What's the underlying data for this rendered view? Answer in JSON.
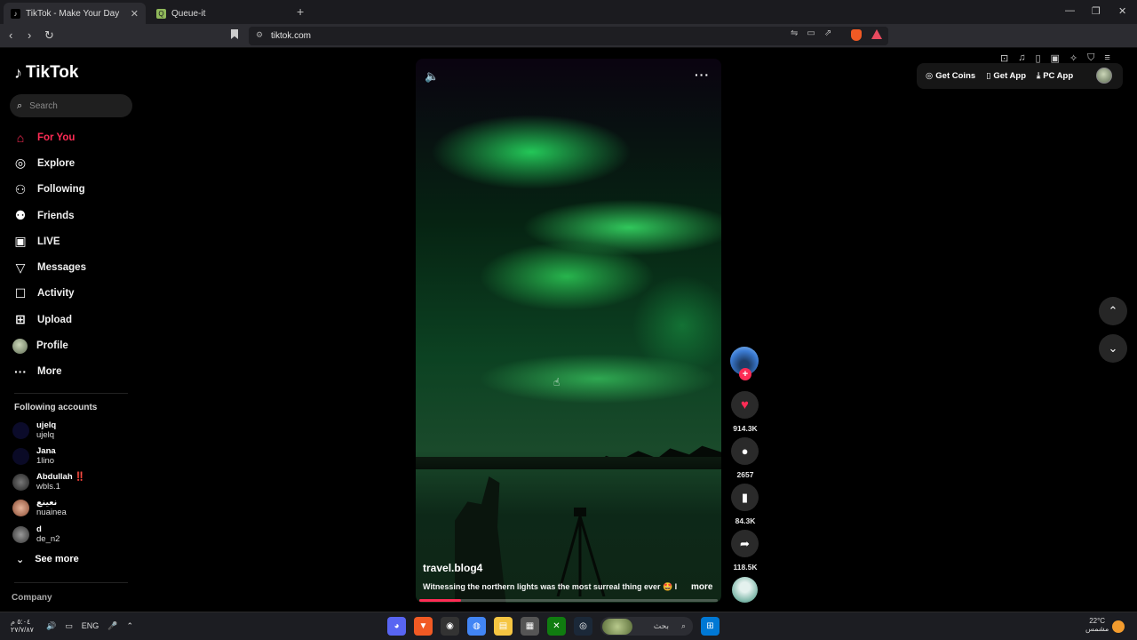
{
  "browser": {
    "tabs": [
      {
        "title": "TikTok - Make Your Day",
        "active": true
      },
      {
        "title": "Queue-it",
        "active": false
      }
    ],
    "url": "tiktok.com"
  },
  "sidebar": {
    "logo": "TikTok",
    "search_placeholder": "Search",
    "nav": [
      {
        "label": "For You",
        "icon": "home-icon",
        "active": true
      },
      {
        "label": "Explore",
        "icon": "compass-icon"
      },
      {
        "label": "Following",
        "icon": "following-icon"
      },
      {
        "label": "Friends",
        "icon": "friends-icon"
      },
      {
        "label": "LIVE",
        "icon": "live-icon"
      },
      {
        "label": "Messages",
        "icon": "messages-icon"
      },
      {
        "label": "Activity",
        "icon": "activity-icon"
      },
      {
        "label": "Upload",
        "icon": "upload-icon"
      },
      {
        "label": "Profile",
        "icon": "profile-avatar"
      },
      {
        "label": "More",
        "icon": "more-icon"
      }
    ],
    "following_title": "Following accounts",
    "accounts": [
      {
        "name": "ujelq",
        "handle": "ujelq"
      },
      {
        "name": "Jana",
        "handle": "1lino"
      },
      {
        "name": "Abdullah ‼️",
        "handle": "wbls.1"
      },
      {
        "name": "نعينع",
        "handle": "nuainea"
      },
      {
        "name": "d",
        "handle": "de_n2"
      }
    ],
    "see_more": "See more",
    "company": "Company"
  },
  "video": {
    "author": "travel.blog4",
    "caption": "Witnessing the northern lights was the most surreal thing ever 🤩 I",
    "caption_more": "more",
    "progress": 0.14
  },
  "actions": {
    "likes": "914.3K",
    "comments": "2657",
    "saves": "84.3K",
    "shares": "118.5K"
  },
  "header": {
    "get_coins": "Get Coins",
    "get_app": "Get App",
    "pc_app": "PC App"
  },
  "taskbar": {
    "time": "٥:٠٤ م",
    "date": "٢٧/٧/٨٧",
    "lang": "ENG",
    "search_label": "بحث",
    "temp": "22°C",
    "weather": "مشمس"
  },
  "colors": {
    "accent": "#fe2c55"
  }
}
